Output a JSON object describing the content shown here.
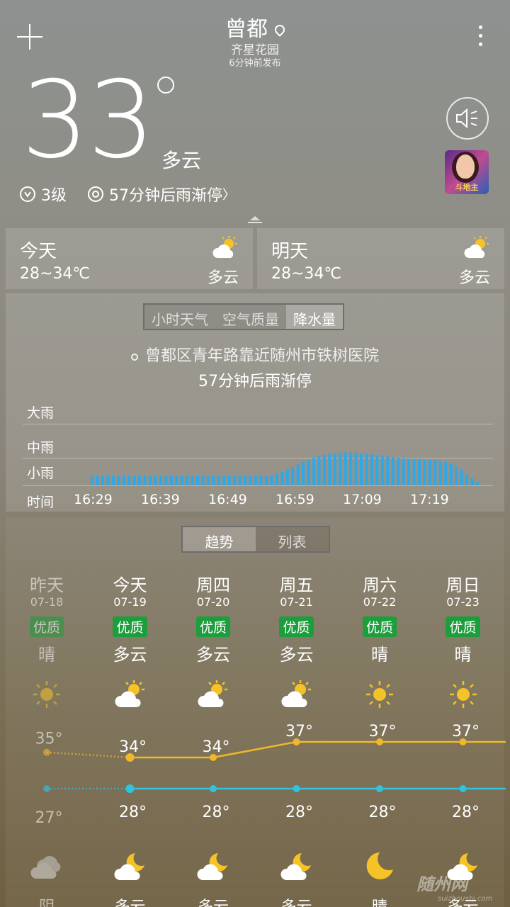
{
  "header": {
    "city": "曾都",
    "district": "齐星花园",
    "published": "6分钟前发布"
  },
  "current": {
    "temp": "33",
    "condition": "多云",
    "wind": "3级",
    "rain_msg": "57分钟后雨渐停",
    "rain_arrow": "〉"
  },
  "ad": {
    "text": "斗地主"
  },
  "today": {
    "title": "今天",
    "range": "28~34℃",
    "cond": "多云"
  },
  "tomorrow": {
    "title": "明天",
    "range": "28~34℃",
    "cond": "多云"
  },
  "precip": {
    "tabs": [
      "小时天气",
      "空气质量",
      "降水量"
    ],
    "active_tab": 2,
    "location": "曾都区青年路靠近随州市铁树医院",
    "nowcast": "57分钟后雨渐停",
    "levels": [
      "大雨",
      "中雨",
      "小雨"
    ],
    "time_label": "时间",
    "times": [
      "16:29",
      "16:39",
      "16:49",
      "16:59",
      "17:09",
      "17:19"
    ],
    "intensity": [
      0.28,
      0.28,
      0.28,
      0.28,
      0.28,
      0.28,
      0.28,
      0.28,
      0.28,
      0.28,
      0.28,
      0.28,
      0.28,
      0.28,
      0.28,
      0.28,
      0.28,
      0.28,
      0.28,
      0.28,
      0.28,
      0.28,
      0.28,
      0.28,
      0.28,
      0.28,
      0.28,
      0.28,
      0.28,
      0.28,
      0.28,
      0.28,
      0.28,
      0.28,
      0.3,
      0.34,
      0.4,
      0.47,
      0.54,
      0.61,
      0.68,
      0.75,
      0.81,
      0.86,
      0.9,
      0.93,
      0.95,
      0.96,
      0.97,
      0.97,
      0.96,
      0.95,
      0.93,
      0.91,
      0.89,
      0.87,
      0.85,
      0.83,
      0.81,
      0.8,
      0.79,
      0.78,
      0.77,
      0.76,
      0.75,
      0.74,
      0.72,
      0.69,
      0.64,
      0.56,
      0.45,
      0.33,
      0.2,
      0.1
    ]
  },
  "trend": {
    "tabs": [
      "趋势",
      "列表"
    ],
    "active_tab": 0,
    "days": [
      {
        "name": "昨天",
        "date": "07-18",
        "aq": "优质",
        "cond": "晴",
        "high": "35°",
        "low": "27°",
        "high_v": 35,
        "low_v": 27,
        "night": "阴",
        "day_icon": "sun-icon",
        "night_icon": "cloud-icon",
        "past": true
      },
      {
        "name": "今天",
        "date": "07-19",
        "aq": "优质",
        "cond": "多云",
        "high": "34°",
        "low": "28°",
        "high_v": 34,
        "low_v": 28,
        "night": "多云",
        "day_icon": "partly-cloudy-icon",
        "night_icon": "moon-cloud-icon"
      },
      {
        "name": "周四",
        "date": "07-20",
        "aq": "优质",
        "cond": "多云",
        "high": "34°",
        "low": "28°",
        "high_v": 34,
        "low_v": 28,
        "night": "多云",
        "day_icon": "partly-cloudy-icon",
        "night_icon": "moon-cloud-icon"
      },
      {
        "name": "周五",
        "date": "07-21",
        "aq": "优质",
        "cond": "多云",
        "high": "37°",
        "low": "28°",
        "high_v": 37,
        "low_v": 28,
        "night": "多云",
        "day_icon": "partly-cloudy-icon",
        "night_icon": "moon-cloud-icon"
      },
      {
        "name": "周六",
        "date": "07-22",
        "aq": "优质",
        "cond": "晴",
        "high": "37°",
        "low": "28°",
        "high_v": 37,
        "low_v": 28,
        "night": "晴",
        "day_icon": "sun-icon",
        "night_icon": "moon-icon"
      },
      {
        "name": "周日",
        "date": "07-23",
        "aq": "优质",
        "cond": "晴",
        "high": "37°",
        "low": "28°",
        "high_v": 37,
        "low_v": 28,
        "night": "多云",
        "day_icon": "sun-icon",
        "night_icon": "moon-cloud-icon"
      }
    ]
  },
  "watermark": {
    "main": "随州网",
    "sub": "suizhoushi.com"
  },
  "colors": {
    "high_line": "#f0b82a",
    "low_line": "#2fc3e0",
    "bar": "#2fa8e8",
    "aq_badge": "#1c9e3c"
  }
}
